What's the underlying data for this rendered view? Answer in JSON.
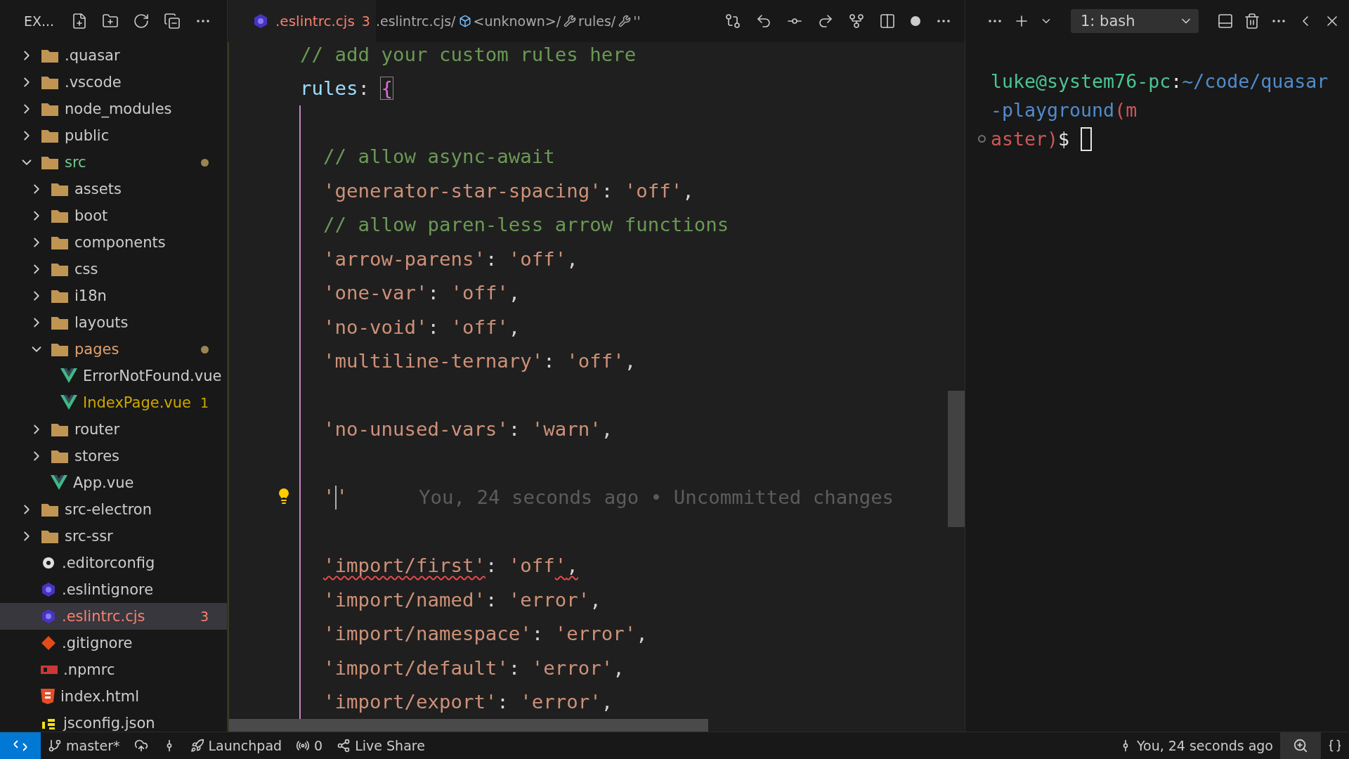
{
  "explorer": {
    "title": "EX..."
  },
  "tree": [
    {
      "label": ".quasar",
      "kind": "folder",
      "expanded": false,
      "selected": false
    },
    {
      "label": ".vscode",
      "kind": "folder",
      "expanded": false,
      "selected": false
    },
    {
      "label": "node_modules",
      "kind": "folder",
      "expanded": false,
      "selected": false
    },
    {
      "label": "public",
      "kind": "folder",
      "expanded": false,
      "selected": false
    },
    {
      "label": "src",
      "kind": "folder",
      "expanded": true,
      "color": "#73c991",
      "selected": false,
      "children": [
        {
          "label": "assets",
          "kind": "folder",
          "expanded": false,
          "selected": false
        },
        {
          "label": "boot",
          "kind": "folder",
          "expanded": false,
          "selected": false
        },
        {
          "label": "components",
          "kind": "folder",
          "expanded": false,
          "selected": false
        },
        {
          "label": "css",
          "kind": "folder",
          "expanded": false,
          "selected": false
        },
        {
          "label": "i18n",
          "kind": "folder",
          "expanded": false,
          "selected": false
        },
        {
          "label": "layouts",
          "kind": "folder",
          "expanded": false,
          "selected": false
        },
        {
          "label": "pages",
          "kind": "folder",
          "expanded": true,
          "color": "#e2a06d",
          "selected": false,
          "children": [
            {
              "label": "ErrorNotFound.vue",
              "kind": "vue",
              "selected": false
            },
            {
              "label": "IndexPage.vue",
              "kind": "vue",
              "color": "#cca700",
              "count": "1",
              "selected": false
            }
          ]
        },
        {
          "label": "router",
          "kind": "folder",
          "expanded": false,
          "selected": false
        },
        {
          "label": "stores",
          "kind": "folder",
          "expanded": false,
          "selected": false
        },
        {
          "label": "App.vue",
          "kind": "vue",
          "selected": false
        }
      ]
    },
    {
      "label": "src-electron",
      "kind": "folder",
      "expanded": false,
      "selected": false
    },
    {
      "label": "src-ssr",
      "kind": "folder",
      "expanded": false,
      "selected": false
    },
    {
      "label": ".editorconfig",
      "kind": "config",
      "selected": false
    },
    {
      "label": ".eslintignore",
      "kind": "eslint",
      "selected": false
    },
    {
      "label": ".eslintrc.cjs",
      "kind": "eslint",
      "color": "#f88070",
      "count": "3",
      "selected": true
    },
    {
      "label": ".gitignore",
      "kind": "git",
      "selected": false
    },
    {
      "label": ".npmrc",
      "kind": "npm",
      "selected": false
    },
    {
      "label": "index.html",
      "kind": "html",
      "selected": false
    },
    {
      "label": "jsconfig.json",
      "kind": "js",
      "selected": false
    }
  ],
  "editor_tab": {
    "label": ".eslintrc.cjs",
    "count": "3"
  },
  "breadcrumbs": [
    {
      "label": ".eslintrc.cjs/",
      "kind": "file"
    },
    {
      "label": "<unknown>/",
      "kind": "symbol"
    },
    {
      "label": "rules/",
      "kind": "property"
    },
    {
      "label": "''",
      "kind": "property"
    }
  ],
  "code_lines": [
    {
      "kind": "code",
      "cursor": false,
      "tokens": [
        {
          "kind": "comment",
          "text": "// add your custom rules here"
        }
      ]
    },
    {
      "kind": "code",
      "cursor": false,
      "tokens": [
        {
          "kind": "key",
          "text": "rules"
        },
        {
          "kind": "punct",
          "text": ": "
        },
        {
          "kind": "bracket",
          "text": "{"
        }
      ],
      "children": [
        {
          "kind": "blank"
        },
        {
          "kind": "code",
          "cursor": false,
          "tokens": [
            {
              "kind": "comment",
              "text": "// allow async-await"
            }
          ]
        },
        {
          "kind": "code",
          "cursor": false,
          "tokens": [
            {
              "kind": "string",
              "text": "'generator-star-spacing'"
            },
            {
              "kind": "punct",
              "text": ": "
            },
            {
              "kind": "string",
              "text": "'off'"
            },
            {
              "kind": "punct",
              "text": ","
            }
          ]
        },
        {
          "kind": "code",
          "cursor": false,
          "tokens": [
            {
              "kind": "comment",
              "text": "// allow paren-less arrow functions"
            }
          ]
        },
        {
          "kind": "code",
          "cursor": false,
          "tokens": [
            {
              "kind": "string",
              "text": "'arrow-parens'"
            },
            {
              "kind": "punct",
              "text": ": "
            },
            {
              "kind": "string",
              "text": "'off'"
            },
            {
              "kind": "punct",
              "text": ","
            }
          ]
        },
        {
          "kind": "code",
          "cursor": false,
          "tokens": [
            {
              "kind": "string",
              "text": "'one-var'"
            },
            {
              "kind": "punct",
              "text": ": "
            },
            {
              "kind": "string",
              "text": "'off'"
            },
            {
              "kind": "punct",
              "text": ","
            }
          ]
        },
        {
          "kind": "code",
          "cursor": false,
          "tokens": [
            {
              "kind": "string",
              "text": "'no-void'"
            },
            {
              "kind": "punct",
              "text": ": "
            },
            {
              "kind": "string",
              "text": "'off'"
            },
            {
              "kind": "punct",
              "text": ","
            }
          ]
        },
        {
          "kind": "code",
          "cursor": false,
          "tokens": [
            {
              "kind": "string",
              "text": "'multiline-ternary'"
            },
            {
              "kind": "punct",
              "text": ": "
            },
            {
              "kind": "string",
              "text": "'off'"
            },
            {
              "kind": "punct",
              "text": ","
            }
          ]
        },
        {
          "kind": "blank"
        },
        {
          "kind": "code",
          "cursor": false,
          "tokens": [
            {
              "kind": "string",
              "text": "'no-unused-vars'"
            },
            {
              "kind": "punct",
              "text": ": "
            },
            {
              "kind": "string",
              "text": "'warn'"
            },
            {
              "kind": "punct",
              "text": ","
            }
          ]
        },
        {
          "kind": "blank"
        },
        {
          "kind": "code",
          "cursor": true,
          "blame": "You, 24 seconds ago • Uncommitted changes",
          "tokens": [
            {
              "kind": "string",
              "text": "'"
            },
            {
              "kind": "string",
              "text": "'"
            }
          ]
        },
        {
          "kind": "blank"
        },
        {
          "kind": "code",
          "cursor": false,
          "tokens": [
            {
              "kind": "string",
              "text": "'import/first'",
              "squiggle": true
            },
            {
              "kind": "punct",
              "text": ": "
            },
            {
              "kind": "string",
              "text": "'off"
            },
            {
              "kind": "string",
              "text": "'",
              "squiggle": true
            },
            {
              "kind": "punct",
              "text": ",",
              "squiggle": true
            }
          ]
        },
        {
          "kind": "code",
          "cursor": false,
          "tokens": [
            {
              "kind": "string",
              "text": "'import/named'"
            },
            {
              "kind": "punct",
              "text": ": "
            },
            {
              "kind": "string",
              "text": "'error'"
            },
            {
              "kind": "punct",
              "text": ","
            }
          ]
        },
        {
          "kind": "code",
          "cursor": false,
          "tokens": [
            {
              "kind": "string",
              "text": "'import/namespace'"
            },
            {
              "kind": "punct",
              "text": ": "
            },
            {
              "kind": "string",
              "text": "'error'"
            },
            {
              "kind": "punct",
              "text": ","
            }
          ]
        },
        {
          "kind": "code",
          "cursor": false,
          "tokens": [
            {
              "kind": "string",
              "text": "'import/default'"
            },
            {
              "kind": "punct",
              "text": ": "
            },
            {
              "kind": "string",
              "text": "'error'"
            },
            {
              "kind": "punct",
              "text": ","
            }
          ]
        },
        {
          "kind": "code",
          "cursor": false,
          "tokens": [
            {
              "kind": "string",
              "text": "'import/export'"
            },
            {
              "kind": "punct",
              "text": ": "
            },
            {
              "kind": "string",
              "text": "'error'"
            },
            {
              "kind": "punct",
              "text": ","
            }
          ]
        }
      ]
    }
  ],
  "terminal": {
    "tab": "1: bash",
    "lines": [
      [
        {
          "kind": "user",
          "text": "luke@system76-pc"
        },
        {
          "kind": "plain",
          "text": ":"
        },
        {
          "kind": "path",
          "text": "~/code/quasar"
        }
      ],
      [
        {
          "kind": "path",
          "text": "-playground"
        },
        {
          "kind": "branch",
          "text": "(m"
        }
      ],
      [
        {
          "kind": "branch",
          "text": "aster)"
        },
        {
          "kind": "plain",
          "text": "$"
        }
      ]
    ]
  },
  "status_bar": {
    "branch": "master*",
    "launchpad": "Launchpad",
    "ports": "0",
    "live_share": "Live Share",
    "blame": "You, 24 seconds ago"
  }
}
